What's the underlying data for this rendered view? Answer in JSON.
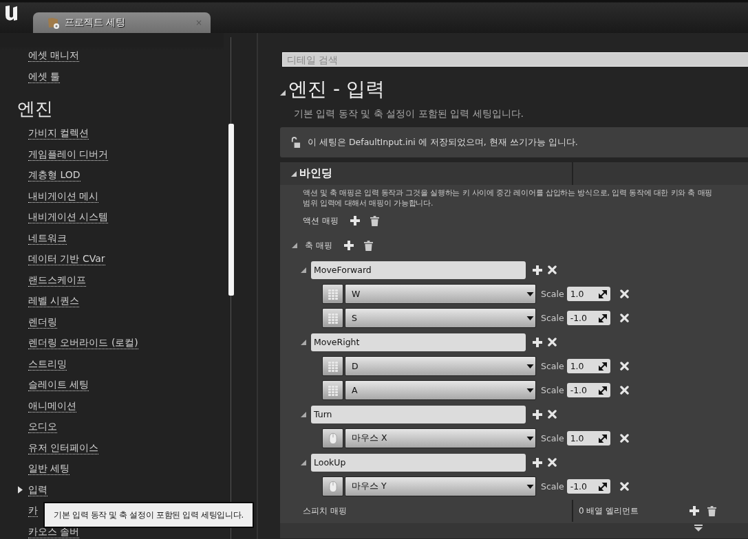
{
  "tab": {
    "title": "프로젝트 세팅",
    "close": "×"
  },
  "sidebar": {
    "items": [
      {
        "label": "에셋 매니저",
        "kind": "item"
      },
      {
        "label": "에셋 툴",
        "kind": "item"
      },
      {
        "label": "엔진",
        "kind": "heading"
      },
      {
        "label": "가비지 컬렉션",
        "kind": "item"
      },
      {
        "label": "게임플레이 디버거",
        "kind": "item"
      },
      {
        "label": "계층형 LOD",
        "kind": "item"
      },
      {
        "label": "내비게이션 메시",
        "kind": "item"
      },
      {
        "label": "내비게이션 시스템",
        "kind": "item"
      },
      {
        "label": "네트워크",
        "kind": "item"
      },
      {
        "label": "데이터 기반 CVar",
        "kind": "item"
      },
      {
        "label": "랜드스케이프",
        "kind": "item"
      },
      {
        "label": "레벨 시퀀스",
        "kind": "item"
      },
      {
        "label": "렌더링",
        "kind": "item"
      },
      {
        "label": "렌더링 오버라이드 (로컬)",
        "kind": "item"
      },
      {
        "label": "스트리밍",
        "kind": "item"
      },
      {
        "label": "슬레이트 세팅",
        "kind": "item"
      },
      {
        "label": "애니메이션",
        "kind": "item"
      },
      {
        "label": "오디오",
        "kind": "item"
      },
      {
        "label": "유저 인터페이스",
        "kind": "item"
      },
      {
        "label": "일반 세팅",
        "kind": "item"
      },
      {
        "label": "입력",
        "kind": "group"
      },
      {
        "label": "카",
        "kind": "item"
      },
      {
        "label": "카오스 솔버",
        "kind": "item"
      }
    ]
  },
  "tooltip": "기본 입력 동작 및 축 설정이 포함된 입력 세팅입니다.",
  "search": {
    "placeholder": "디테일 검색"
  },
  "title": "엔진 - 입력",
  "description": "기본 입력 동작 및 축 설정이 포함된 입력 세팅입니다.",
  "notice": "이 세팅은 DefaultInput.ini 에 저장되었으며, 현재 쓰기가능 입니다.",
  "binding": {
    "title": "바인딩",
    "description": [
      "액션 및 축 매핑은 입력 동작과 그것을 실행하는 키 사이에 중간 레이어를 삽입하는 방식으로, 입력 동작에 대한 키와 축 매핑",
      "범위 입력에 대해서 매핑이 가능합니다."
    ],
    "action_mappings": "액션 매핑",
    "axis_mappings": "축 매핑",
    "axes": [
      {
        "name": "MoveForward",
        "keys": [
          {
            "kind": "keyboard",
            "key": "W",
            "scale_label": "Scale",
            "scale": "1.0"
          },
          {
            "kind": "keyboard",
            "key": "S",
            "scale_label": "Scale",
            "scale": "-1.0"
          }
        ]
      },
      {
        "name": "MoveRight",
        "keys": [
          {
            "kind": "keyboard",
            "key": "D",
            "scale_label": "Scale",
            "scale": "1.0"
          },
          {
            "kind": "keyboard",
            "key": "A",
            "scale_label": "Scale",
            "scale": "-1.0"
          }
        ]
      },
      {
        "name": "Turn",
        "keys": [
          {
            "kind": "mouse",
            "key": "마우스 X",
            "scale_label": "Scale",
            "scale": "1.0"
          }
        ]
      },
      {
        "name": "LookUp",
        "keys": [
          {
            "kind": "mouse",
            "key": "마우스 Y",
            "scale_label": "Scale",
            "scale": "-1.0"
          }
        ]
      }
    ],
    "speech": {
      "label": "스피치 매핑",
      "value": "0 배열 엘리먼트"
    }
  }
}
